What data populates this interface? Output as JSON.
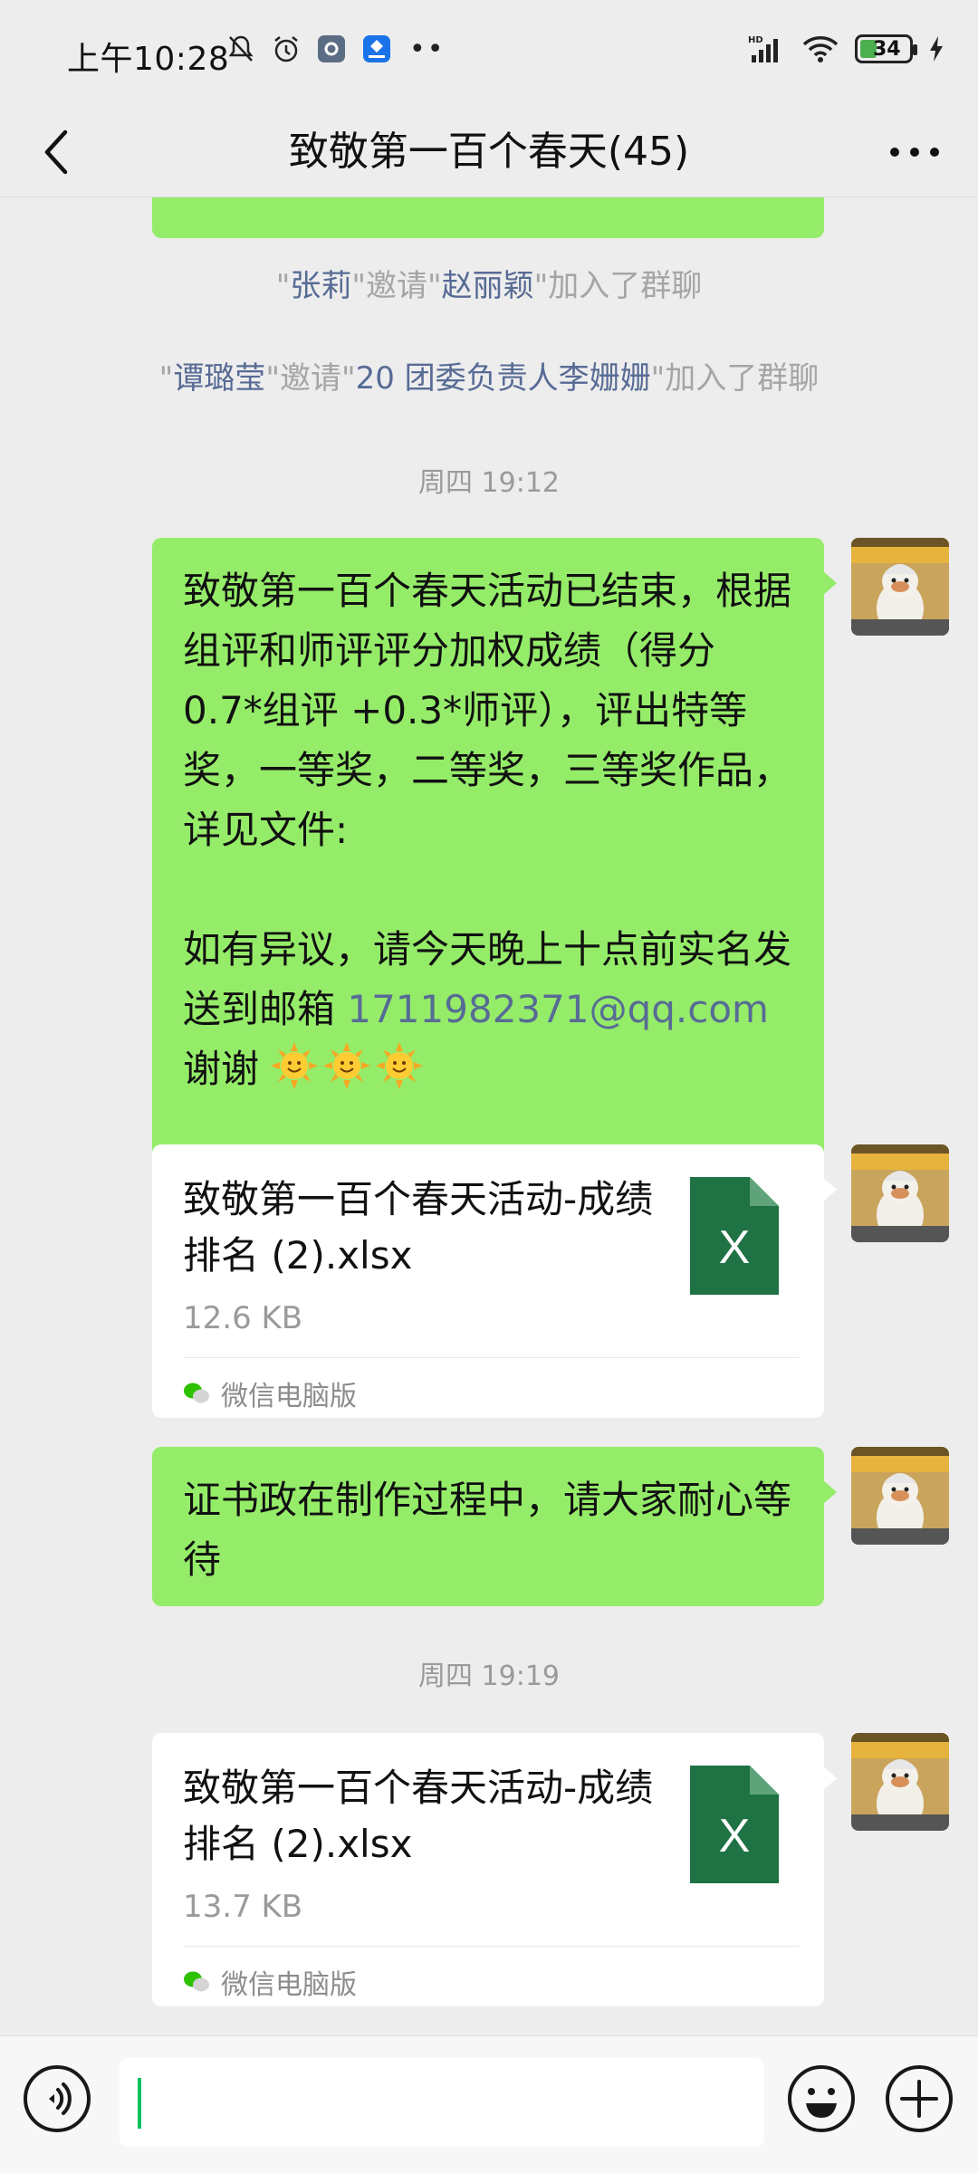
{
  "status_bar": {
    "time": "上午10:28",
    "battery": "34",
    "network": "HD"
  },
  "header": {
    "title": "致敬第一百个春天(45)"
  },
  "system_messages": [
    {
      "q1": "\"",
      "inviter": "张莉",
      "q2": "\"邀请\"",
      "invitee": "赵丽颖",
      "tail": "\"加入了群聊"
    },
    {
      "q1": "\"",
      "inviter": "谭璐莹",
      "q2": "\"邀请\"",
      "invitee": "20 团委负责人李姗姗",
      "tail": "\"加入了群聊"
    }
  ],
  "timestamps": [
    "周四 19:12",
    "周四 19:19"
  ],
  "messages": {
    "m1": {
      "line1": "致敬第一百个春天活动已结束，根据组评和师评评分加权成绩（得分0.7*组评 +0.3*师评），评出特等奖，一等奖，二等奖，三等奖作品，详见文件:",
      "line2": "如有异议，请今天晚上十点前实名发送到邮箱 ",
      "email": "1711982371@qq.com",
      "line3": "谢谢"
    },
    "file1": {
      "name": "致敬第一百个春天活动-成绩排名 (2).xlsx",
      "size": "12.6 KB",
      "source": "微信电脑版",
      "icon_letter": "X"
    },
    "m2": {
      "text": "证书政在制作过程中，请大家耐心等待"
    },
    "file2": {
      "name": "致敬第一百个春天活动-成绩排名 (2).xlsx",
      "size": "13.7 KB",
      "source": "微信电脑版",
      "icon_letter": "X"
    }
  },
  "colors": {
    "bubble_green": "#95ec69",
    "link_blue": "#576b95",
    "excel_green": "#1f7244"
  }
}
